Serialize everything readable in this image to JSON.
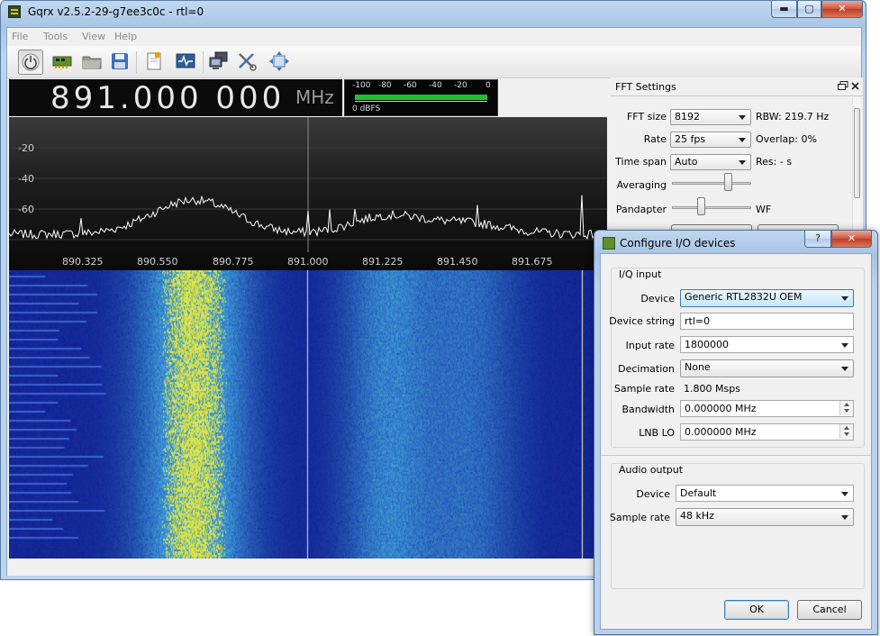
{
  "window": {
    "title": "Gqrx v2.5.2-29-g7ee3c0c - rtl=0",
    "minimize": "▬",
    "maximize": "▢",
    "close": "✕"
  },
  "menu": [
    "File",
    "Tools",
    "View",
    "Help"
  ],
  "freq": {
    "value": "891.000 000",
    "unit": "MHz"
  },
  "meter": {
    "ticks": [
      "-100",
      "-80",
      "-60",
      "-40",
      "-20",
      "0"
    ],
    "readout": "0 dBFS",
    "level_fraction": 1.0
  },
  "spectrum": {
    "y_ticks": [
      "-20",
      "-40",
      "-60"
    ],
    "x_ticks": [
      "890.325",
      "890.550",
      "890.775",
      "891.000",
      "891.225",
      "891.450",
      "891.675"
    ]
  },
  "fft": {
    "title": "FFT Settings",
    "fft_size_label": "FFT size",
    "fft_size": "8192",
    "rbw": "RBW: 219.7 Hz",
    "rate_label": "Rate",
    "rate": "25 fps",
    "overlap": "Overlap: 0%",
    "timespan_label": "Time span",
    "timespan": "Auto",
    "res": "Res: - s",
    "averaging_label": "Averaging",
    "averaging_fraction": 0.72,
    "pandapter_label": "Pandapter",
    "wf_label": "WF",
    "pandapter_fraction": 0.35
  },
  "dialog": {
    "title": "Configure I/O devices",
    "help": "?",
    "close": "✕",
    "iq_group": "I/Q input",
    "device_label": "Device",
    "device": "Generic RTL2832U OEM",
    "devstr_label": "Device string",
    "devstr": "rtl=0",
    "inrate_label": "Input rate",
    "inrate": "1800000",
    "decim_label": "Decimation",
    "decim": "None",
    "srate_label": "Sample rate",
    "srate": "1.800 Msps",
    "bw_label": "Bandwidth",
    "bw": "0.000000 MHz",
    "lnb_label": "LNB LO",
    "lnb": "0.000000 MHz",
    "audio_group": "Audio output",
    "adev_label": "Device",
    "adev": "Default",
    "asrate_label": "Sample rate",
    "asrate": "48 kHz",
    "ok": "OK",
    "cancel": "Cancel"
  },
  "colors": {
    "trace": "#ffffff",
    "waterfall_base": "#1a2aa8",
    "meter_bar": "#1fbf2d"
  }
}
